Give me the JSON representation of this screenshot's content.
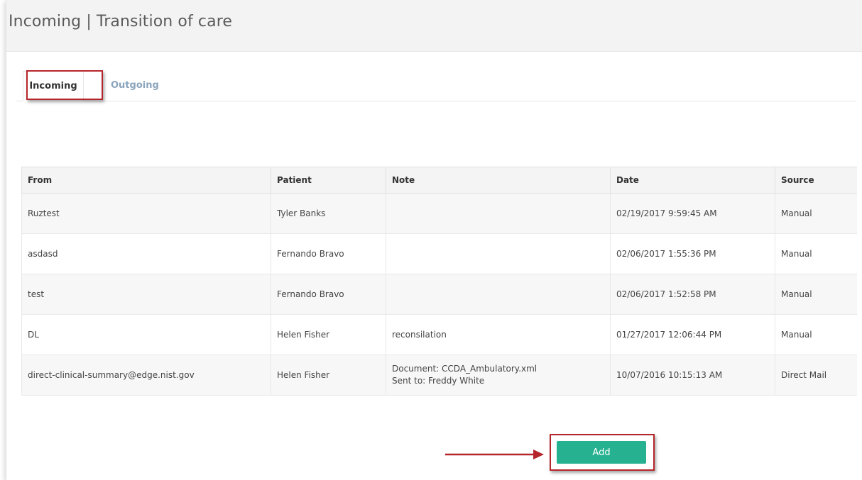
{
  "header": {
    "title": "Incoming | Transition of care"
  },
  "tabs": [
    {
      "label": "Incoming",
      "active": true
    },
    {
      "label": "Outgoing",
      "active": false
    }
  ],
  "table": {
    "columns": [
      "From",
      "Patient",
      "Note",
      "Date",
      "Source"
    ],
    "rows": [
      {
        "from": "Ruztest",
        "patient": "Tyler Banks",
        "note": [
          "",
          ""
        ],
        "date": "02/19/2017 9:59:45 AM",
        "source": "Manual"
      },
      {
        "from": "asdasd",
        "patient": "Fernando Bravo",
        "note": [
          "",
          ""
        ],
        "date": "02/06/2017 1:55:36 PM",
        "source": "Manual"
      },
      {
        "from": "test",
        "patient": "Fernando Bravo",
        "note": [
          "",
          ""
        ],
        "date": "02/06/2017 1:52:58 PM",
        "source": "Manual"
      },
      {
        "from": "DL",
        "patient": "Helen Fisher",
        "note": [
          "reconsilation",
          ""
        ],
        "date": "01/27/2017 12:06:44 PM",
        "source": "Manual"
      },
      {
        "from": "direct-clinical-summary@edge.nist.gov",
        "patient": "Helen Fisher",
        "note": [
          "Document: CCDA_Ambulatory.xml",
          "Sent to: Freddy White"
        ],
        "date": "10/07/2016 10:15:13 AM",
        "source": "Direct Mail"
      }
    ]
  },
  "actions": {
    "add_label": "Add"
  },
  "colors": {
    "accent": "#26b290",
    "highlight": "#b5262c",
    "tab_inactive": "#8aa4bc"
  },
  "icons": {
    "annotation_arrow": "arrow-right-icon"
  }
}
